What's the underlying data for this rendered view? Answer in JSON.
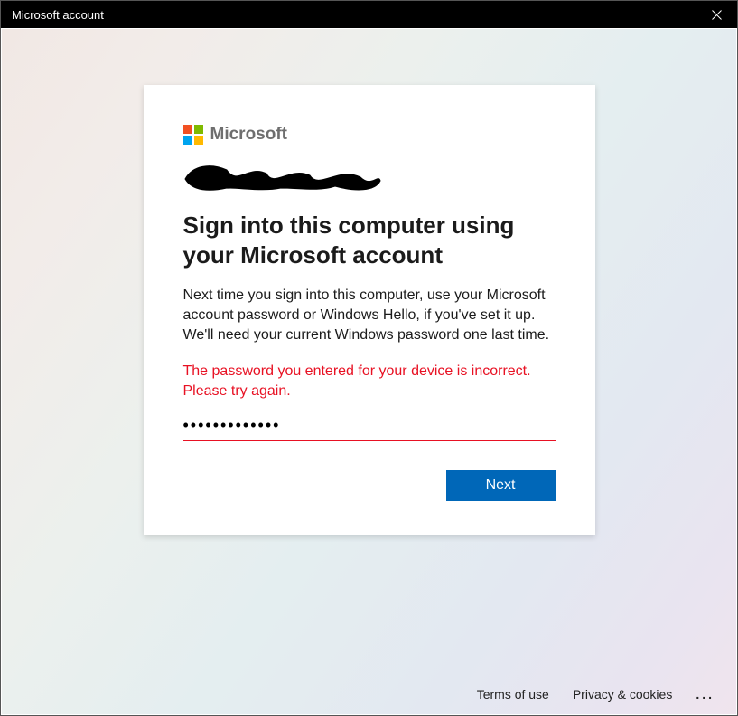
{
  "window": {
    "title": "Microsoft account"
  },
  "brand": {
    "name": "Microsoft"
  },
  "content": {
    "heading": "Sign into this computer using your Microsoft account",
    "body_line1": "Next time you sign into this computer, use your Microsoft account password or Windows Hello, if you've set it up.",
    "body_line2": "We'll need your current Windows password one last time.",
    "error": "The password you entered for your device is incorrect. Please try again.",
    "password_value": "•••••••••••••",
    "next_label": "Next"
  },
  "footer": {
    "terms": "Terms of use",
    "privacy": "Privacy & cookies"
  }
}
